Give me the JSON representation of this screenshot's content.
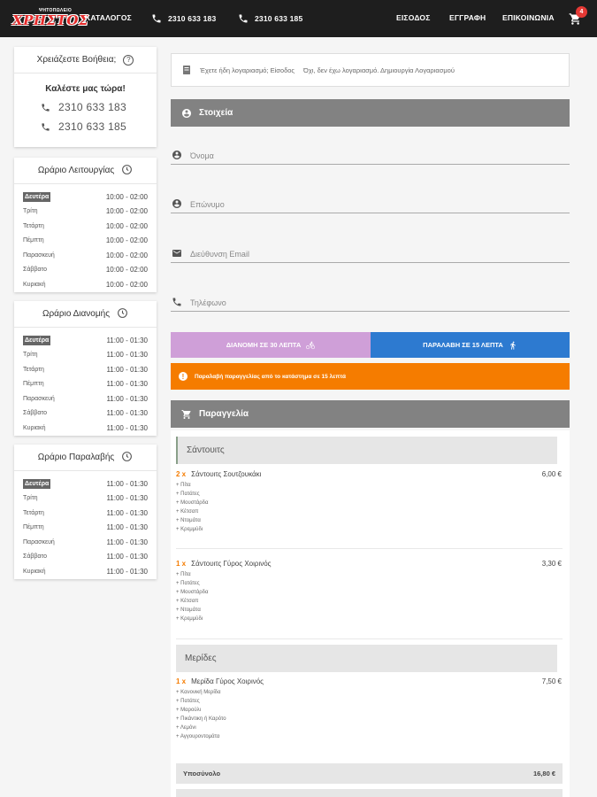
{
  "header": {
    "logo_small": "ΨΗΤΟΠΩΛΕΙΟ",
    "logo_big": "ΧΡΗΣΤΟΣ",
    "catalog": "ΚΑΤΑΛΟΓΟΣ",
    "phone1": "2310 633 183",
    "phone2": "2310 633 185",
    "login": "ΕΙΣΟΔΟΣ",
    "register": "ΕΓΓΡΑΦΗ",
    "contact": "ΕΠΙΚΟΙΝΩΝΙΑ",
    "cart_count": "4"
  },
  "help": {
    "title": "Χρειάζεστε Βοήθεια;",
    "call_now": "Καλέστε μας τώρα!",
    "phone1": "2310 633 183",
    "phone2": "2310 633 185"
  },
  "hours": {
    "title": "Ωράριο Λειτουργίας",
    "rows": [
      {
        "day": "Δευτέρα",
        "hours": "10:00 - 02:00"
      },
      {
        "day": "Τρίτη",
        "hours": "10:00 - 02:00"
      },
      {
        "day": "Τετάρτη",
        "hours": "10:00 - 02:00"
      },
      {
        "day": "Πέμπτη",
        "hours": "10:00 - 02:00"
      },
      {
        "day": "Παρασκευή",
        "hours": "10:00 - 02:00"
      },
      {
        "day": "Σάββατο",
        "hours": "10:00 - 02:00"
      },
      {
        "day": "Κυριακή",
        "hours": "10:00 - 02:00"
      }
    ]
  },
  "delivery_hours": {
    "title": "Ωράριο Διανομής",
    "rows": [
      {
        "day": "Δευτέρα",
        "hours": "11:00 - 01:30"
      },
      {
        "day": "Τρίτη",
        "hours": "11:00 - 01:30"
      },
      {
        "day": "Τετάρτη",
        "hours": "11:00 - 01:30"
      },
      {
        "day": "Πέμπτη",
        "hours": "11:00 - 01:30"
      },
      {
        "day": "Παρασκευή",
        "hours": "11:00 - 01:30"
      },
      {
        "day": "Σάββατο",
        "hours": "11:00 - 01:30"
      },
      {
        "day": "Κυριακή",
        "hours": "11:00 - 01:30"
      }
    ]
  },
  "pickup_hours": {
    "title": "Ωράριο Παραλαβής",
    "rows": [
      {
        "day": "Δευτέρα",
        "hours": "11:00 - 01:30"
      },
      {
        "day": "Τρίτη",
        "hours": "11:00 - 01:30"
      },
      {
        "day": "Τετάρτη",
        "hours": "11:00 - 01:30"
      },
      {
        "day": "Πέμπτη",
        "hours": "11:00 - 01:30"
      },
      {
        "day": "Παρασκευή",
        "hours": "11:00 - 01:30"
      },
      {
        "day": "Σάββατο",
        "hours": "11:00 - 01:30"
      },
      {
        "day": "Κυριακή",
        "hours": "11:00 - 01:30"
      }
    ]
  },
  "login_box": {
    "existing": "Έχετε ήδη λογαριασμό; Είσοδος",
    "new": "Όχι, δεν έχω λογαριασμό. Δημιουργία Λογαριασμού"
  },
  "details": {
    "title": "Στοιχεία",
    "name_placeholder": "Όνομα",
    "surname_placeholder": "Επώνυμο",
    "email_placeholder": "Διεύθυνση Email",
    "phone_placeholder": "Τηλέφωνο"
  },
  "modes": {
    "delivery": "ΔΙΑΝΟΜΗ ΣΕ 30 ΛΕΠΤΑ",
    "pickup": "ΠΑΡΑΛΑΒΗ ΣΕ 15 ΛΕΠΤΑ"
  },
  "alert": "Παραλαβή παραγγελίας από το κατάστημα σε 15 λεπτά",
  "order": {
    "title": "Παραγγελία",
    "categories": [
      {
        "name": "Σάντουιτς",
        "items": [
          {
            "qty": "2 x",
            "name": "Σάντουιτς Σουτζουκάκι",
            "price": "6,00 €",
            "extras": [
              "+ Πίτα",
              "+ Πατάτες",
              "+ Μουστάρδα",
              "+ Κέτσαπ",
              "+ Ντομάτα",
              "+ Κρεμμύδι"
            ]
          },
          {
            "qty": "1 x",
            "name": "Σάντουιτς Γύρος Χοιρινός",
            "price": "3,30 €",
            "extras": [
              "+ Πίτα",
              "+ Πατάτες",
              "+ Μουστάρδα",
              "+ Κέτσαπ",
              "+ Ντομάτα",
              "+ Κρεμμύδι"
            ]
          }
        ]
      },
      {
        "name": "Μερίδες",
        "items": [
          {
            "qty": "1 x",
            "name": "Μερίδα Γύρος Χοιρινός",
            "price": "7,50 €",
            "extras": [
              "+ Κανονική Μερίδα",
              "+ Πατάτες",
              "+ Μαρούλι",
              "+ Πικάντικη ή Καρότο",
              "+ Λεμόνι",
              "+ Αγγουροντομάτα"
            ]
          }
        ]
      }
    ],
    "subtotal_label": "Υποσύνολο",
    "subtotal_value": "16,80 €"
  },
  "colors": {
    "topbar": "#1e1e1e",
    "delivery": "#cf9fd8",
    "pickup": "#2d7ad0",
    "alert": "#f57c00",
    "section": "#828282"
  }
}
